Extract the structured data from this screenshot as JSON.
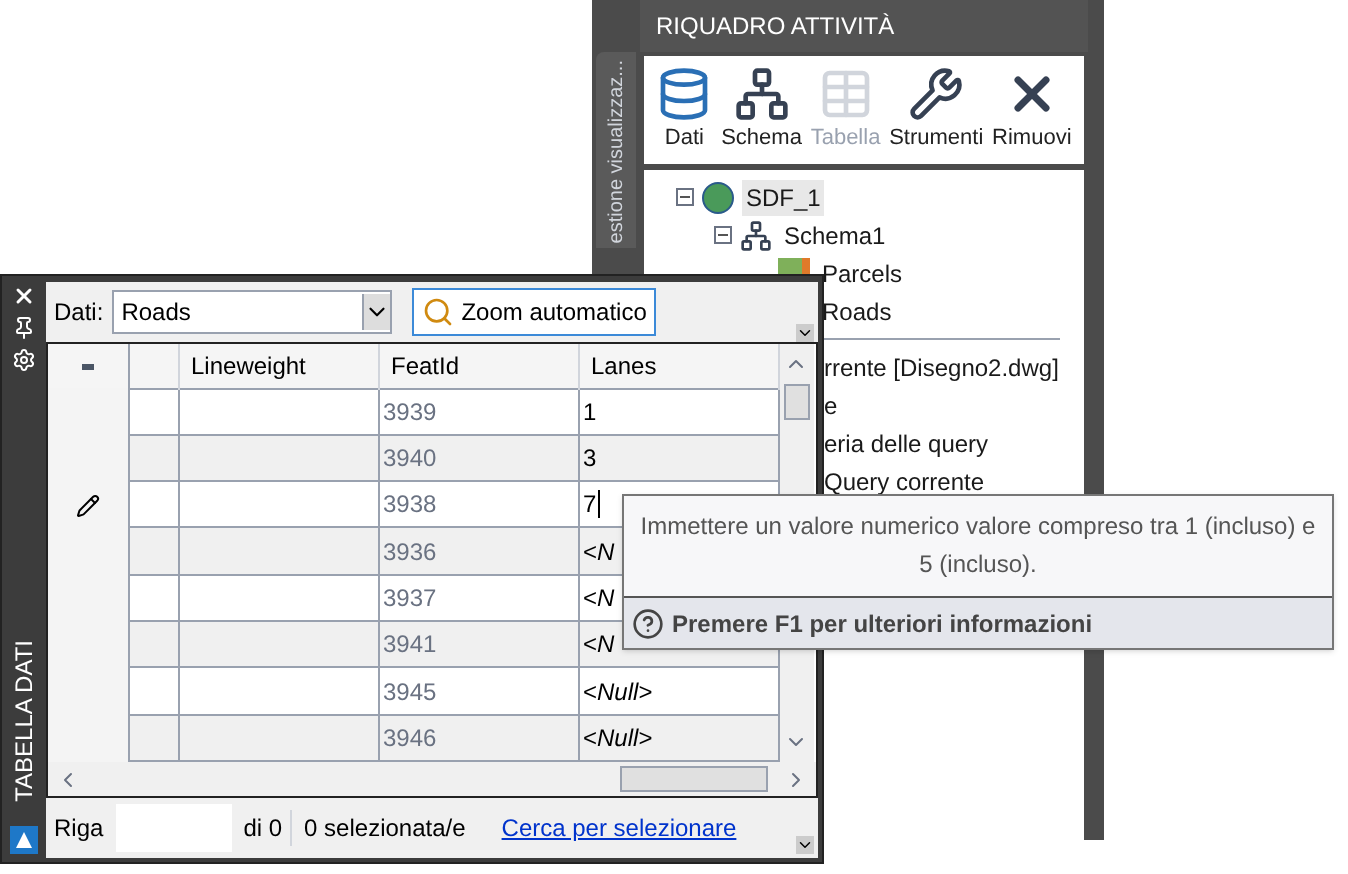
{
  "task_pane": {
    "side_tab": "estione visualizzaz...",
    "title": "RIQUADRO ATTIVITÀ",
    "toolbar": [
      {
        "label": "Dati",
        "kind": "data",
        "disabled": false
      },
      {
        "label": "Schema",
        "kind": "schema",
        "disabled": false
      },
      {
        "label": "Tabella",
        "kind": "table",
        "disabled": true
      },
      {
        "label": "Strumenti",
        "kind": "tools",
        "disabled": false
      },
      {
        "label": "Rimuovi",
        "kind": "remove",
        "disabled": false
      }
    ],
    "tree": [
      {
        "label": "SDF_1",
        "kind": "source",
        "expanded": true,
        "selected": true,
        "children": [
          {
            "label": "Schema1",
            "kind": "schema",
            "expanded": true,
            "selected": false,
            "children": [
              {
                "label": "Parcels",
                "kind": "feature",
                "selected": false
              },
              {
                "label": "Roads",
                "kind": "feature",
                "selected": false
              }
            ]
          }
        ]
      }
    ],
    "menu_fragments": [
      "rrente [Disegno2.dwg]",
      "e",
      "eria delle query",
      "Query corrente"
    ]
  },
  "data_table": {
    "side_title": "TABELLA DATI",
    "data_label": "Dati:",
    "data_value": "Roads",
    "zoom_button": "Zoom automatico",
    "columns": [
      "Lineweight",
      "FeatId",
      "Lanes"
    ],
    "rows": [
      {
        "featid": "3939",
        "lanes": "1",
        "editing": false
      },
      {
        "featid": "3940",
        "lanes": "3",
        "editing": false
      },
      {
        "featid": "3938",
        "lanes": "7",
        "editing": true
      },
      {
        "featid": "3936",
        "lanes": "<*N*",
        "editing": false
      },
      {
        "featid": "3937",
        "lanes": "<*N*",
        "editing": false
      },
      {
        "featid": "3941",
        "lanes": "<*N*",
        "editing": false
      },
      {
        "featid": "3945",
        "lanes": "<*Null*>",
        "editing": false
      },
      {
        "featid": "3946",
        "lanes": "<*Null*>",
        "editing": false
      }
    ],
    "status": {
      "row_label": "Riga",
      "of": "di 0",
      "selected": "0 selezionata/e",
      "link": "Cerca per selezionare"
    }
  },
  "tooltip": {
    "message": "Immettere un valore numerico valore compreso tra 1 (incluso) e 5 (incluso).",
    "help": "Premere F1 per ulteriori informazioni"
  }
}
